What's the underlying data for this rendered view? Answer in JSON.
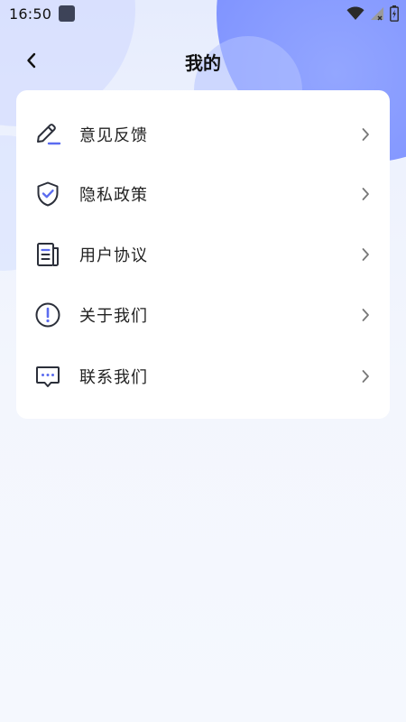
{
  "status_bar": {
    "time": "16:50"
  },
  "header": {
    "title": "我的",
    "back_icon": "chevron-left-icon"
  },
  "menu": {
    "items": [
      {
        "label": "意见反馈",
        "icon": "edit-pen-icon"
      },
      {
        "label": "隐私政策",
        "icon": "shield-check-icon"
      },
      {
        "label": "用户协议",
        "icon": "document-icon"
      },
      {
        "label": "关于我们",
        "icon": "info-circle-icon"
      },
      {
        "label": "联系我们",
        "icon": "chat-bubble-icon"
      }
    ]
  },
  "colors": {
    "accent": "#5b6cf0",
    "icon_stroke": "#2b2f3a",
    "card_bg": "#ffffff",
    "page_bg": "#f3f6fd"
  }
}
